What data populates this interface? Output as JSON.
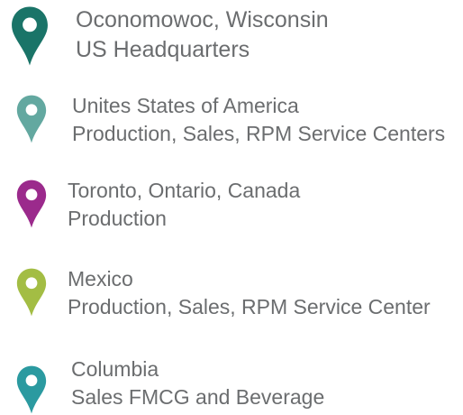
{
  "locations": [
    {
      "title": "Oconomowoc, Wisconsin",
      "subtitle": "US Headquarters",
      "pin_color": "#1a7468",
      "icon": "map-pin-icon"
    },
    {
      "title": "Unites States of America",
      "subtitle": "Production, Sales, RPM Service Centers",
      "pin_color": "#63a8a0",
      "icon": "map-pin-icon"
    },
    {
      "title": "Toronto, Ontario, Canada",
      "subtitle": "Production",
      "pin_color": "#9b2a8c",
      "icon": "map-pin-icon"
    },
    {
      "title": "Mexico",
      "subtitle": "Production, Sales, RPM Service Center",
      "pin_color": "#a3bd44",
      "icon": "map-pin-icon"
    },
    {
      "title": "Columbia",
      "subtitle": "Sales FMCG and Beverage",
      "pin_color": "#2b9aa0",
      "icon": "map-pin-icon"
    }
  ]
}
